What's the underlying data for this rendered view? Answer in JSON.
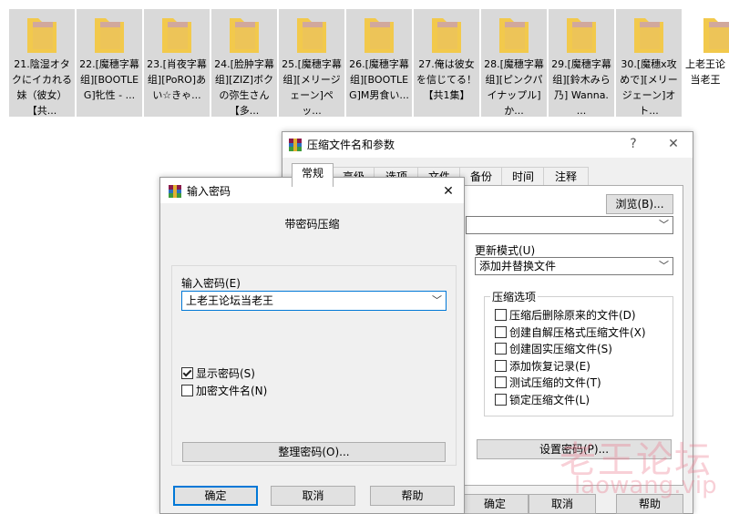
{
  "folders": [
    {
      "name": "21.陰湿オタクにイカれる妹（彼女）【共..."
    },
    {
      "name": "22.[魔穗字幕组][BOOTLEG]牝性 - ..."
    },
    {
      "name": "23.[肖夜字幕组][PoRO]あい☆きゃ..."
    },
    {
      "name": "24.[脸肿字幕组][ZIZ]ボクの弥生さん【多..."
    },
    {
      "name": "25.[魔穗字幕组][メリージェーン]ペッ..."
    },
    {
      "name": "26.[魔穗字幕组][BOOTLEG]M男食い..."
    },
    {
      "name": "27.俺は彼女を信じてる！【共1集】"
    },
    {
      "name": "28.[魔穗字幕组][ピンクパイナップル] か..."
    },
    {
      "name": "29.[魔穗字幕组][鈴木みら乃] Wanna. ..."
    },
    {
      "name": "30.[魔穗x攻めで][メリージェーン]オト..."
    },
    {
      "name": "上老王论当老王"
    }
  ],
  "back_window": {
    "title": "压缩文件名和参数",
    "help": "?",
    "close": "✕",
    "tabs": [
      "常规",
      "高级",
      "选项",
      "文件",
      "备份",
      "时间",
      "注释"
    ],
    "browse_label": "浏览(B)...",
    "update_mode_label": "更新模式(U)",
    "update_mode_value": "添加并替换文件",
    "options_label": "压缩选项",
    "options": [
      {
        "label": "压缩后删除原来的文件(D)",
        "checked": false
      },
      {
        "label": "创建自解压格式压缩文件(X)",
        "checked": false
      },
      {
        "label": "创建固实压缩文件(S)",
        "checked": false
      },
      {
        "label": "添加恢复记录(E)",
        "checked": false
      },
      {
        "label": "测试压缩的文件(T)",
        "checked": false
      },
      {
        "label": "锁定压缩文件(L)",
        "checked": false
      }
    ],
    "set_password_label": "设置密码(P)...",
    "ok_label": "确定",
    "cancel_label": "取消",
    "help_label": "帮助"
  },
  "front_window": {
    "title": "输入密码",
    "close": "✕",
    "heading": "带密码压缩",
    "password_label": "输入密码(E)",
    "password_value": "上老王论坛当老王",
    "show_password": {
      "label": "显示密码(S)",
      "checked": true
    },
    "encrypt_names": {
      "label": "加密文件名(N)",
      "checked": false
    },
    "organize_label": "整理密码(O)...",
    "ok_label": "确定",
    "cancel_label": "取消",
    "help_label": "帮助"
  },
  "watermark": {
    "line1": "老王论坛",
    "line2": "laowang.vip"
  },
  "colors": {
    "folder_yellow": "#f2c94c",
    "accent_blue": "#0078d7",
    "selection_gray": "#d9d9d9"
  }
}
